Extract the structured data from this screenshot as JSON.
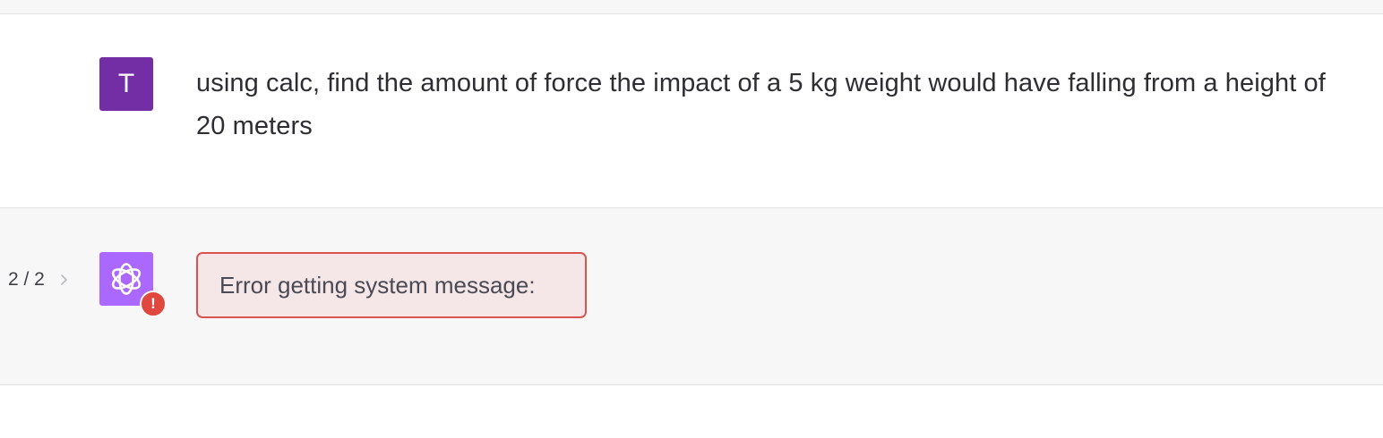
{
  "user_message": {
    "avatar_initial": "T",
    "text": "using calc, find the amount of force the impact of a 5 kg weight would have falling from a height of 20 meters"
  },
  "assistant_message": {
    "pager": "2 / 2",
    "avatar_icon": "openai-logo-icon",
    "status_icon": "error-exclamation-icon",
    "status_symbol": "!",
    "error_text": "Error getting system message:"
  },
  "colors": {
    "user_avatar": "#732ea6",
    "bot_avatar": "#ab68ff",
    "error_border": "#d9534f",
    "error_background": "#f5e6e7",
    "row_alt_background": "#f7f7f8"
  }
}
